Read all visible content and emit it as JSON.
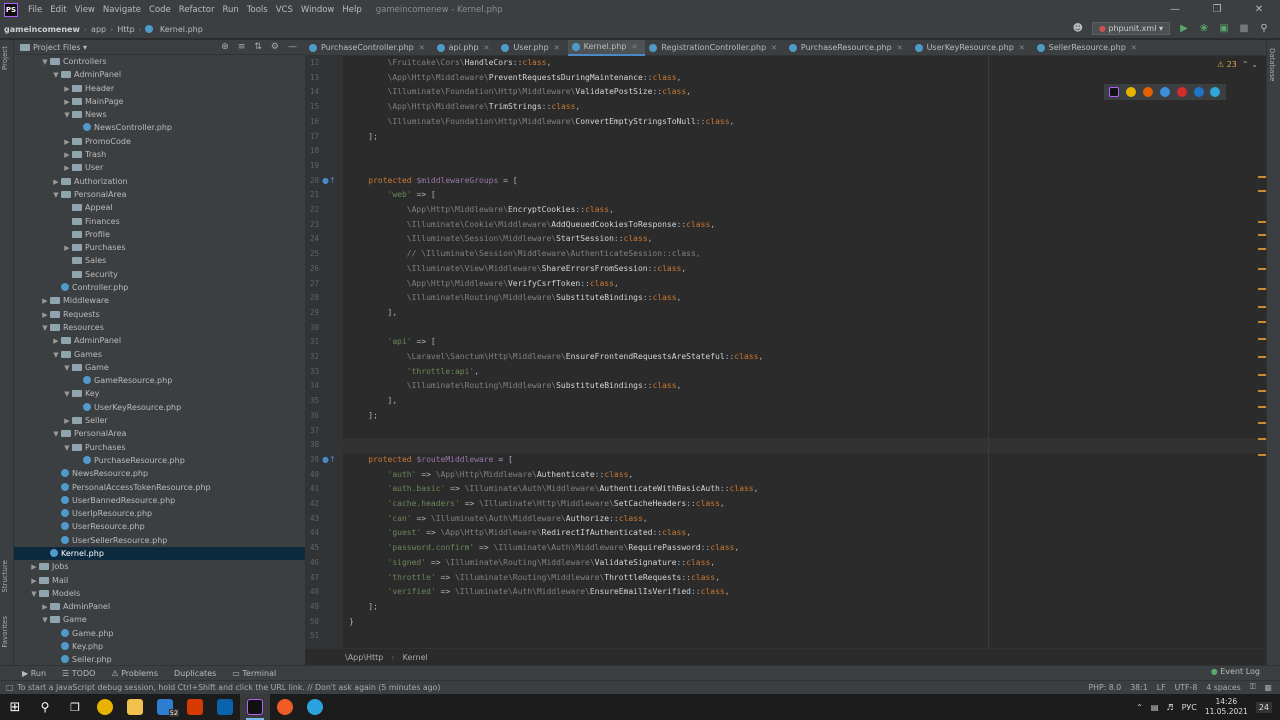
{
  "window": {
    "menu": [
      "File",
      "Edit",
      "View",
      "Navigate",
      "Code",
      "Refactor",
      "Run",
      "Tools",
      "VCS",
      "Window",
      "Help"
    ],
    "title": "gameincomenew - Kernel.php",
    "logo": "PS"
  },
  "navbar": {
    "crumbs": [
      "gameincomenew",
      "app",
      "Http",
      "Kernel.php"
    ],
    "run_config": "phpunit.xml"
  },
  "project": {
    "header": "Project Files",
    "stripe_labels": {
      "project": "Project",
      "structure": "Structure",
      "favorites": "Favorites"
    },
    "tree": [
      {
        "label": "Controllers",
        "type": "folder",
        "depth": 2,
        "arrow": "v"
      },
      {
        "label": "AdminPanel",
        "type": "folder",
        "depth": 3,
        "arrow": "v"
      },
      {
        "label": "Header",
        "type": "folder",
        "depth": 4,
        "arrow": ">"
      },
      {
        "label": "MainPage",
        "type": "folder",
        "depth": 4,
        "arrow": ">"
      },
      {
        "label": "News",
        "type": "folder",
        "depth": 4,
        "arrow": "v"
      },
      {
        "label": "NewsController.php",
        "type": "php",
        "depth": 5,
        "arrow": ""
      },
      {
        "label": "PromoCode",
        "type": "folder",
        "depth": 4,
        "arrow": ">"
      },
      {
        "label": "Trash",
        "type": "folder",
        "depth": 4,
        "arrow": ">"
      },
      {
        "label": "User",
        "type": "folder",
        "depth": 4,
        "arrow": ">"
      },
      {
        "label": "Authorization",
        "type": "folder",
        "depth": 3,
        "arrow": ">"
      },
      {
        "label": "PersonalArea",
        "type": "folder",
        "depth": 3,
        "arrow": "v"
      },
      {
        "label": "Appeal",
        "type": "folder",
        "depth": 4,
        "arrow": ""
      },
      {
        "label": "Finances",
        "type": "folder",
        "depth": 4,
        "arrow": ""
      },
      {
        "label": "Profile",
        "type": "folder",
        "depth": 4,
        "arrow": ""
      },
      {
        "label": "Purchases",
        "type": "folder",
        "depth": 4,
        "arrow": ">"
      },
      {
        "label": "Sales",
        "type": "folder",
        "depth": 4,
        "arrow": ""
      },
      {
        "label": "Security",
        "type": "folder",
        "depth": 4,
        "arrow": ""
      },
      {
        "label": "Controller.php",
        "type": "php",
        "depth": 3,
        "arrow": ""
      },
      {
        "label": "Middleware",
        "type": "folder",
        "depth": 2,
        "arrow": ">"
      },
      {
        "label": "Requests",
        "type": "folder",
        "depth": 2,
        "arrow": ">"
      },
      {
        "label": "Resources",
        "type": "folder",
        "depth": 2,
        "arrow": "v"
      },
      {
        "label": "AdminPanel",
        "type": "folder",
        "depth": 3,
        "arrow": ">"
      },
      {
        "label": "Games",
        "type": "folder",
        "depth": 3,
        "arrow": "v"
      },
      {
        "label": "Game",
        "type": "folder",
        "depth": 4,
        "arrow": "v"
      },
      {
        "label": "GameResource.php",
        "type": "php",
        "depth": 5,
        "arrow": ""
      },
      {
        "label": "Key",
        "type": "folder",
        "depth": 4,
        "arrow": "v"
      },
      {
        "label": "UserKeyResource.php",
        "type": "php",
        "depth": 5,
        "arrow": ""
      },
      {
        "label": "Seller",
        "type": "folder",
        "depth": 4,
        "arrow": ">"
      },
      {
        "label": "PersonalArea",
        "type": "folder",
        "depth": 3,
        "arrow": "v"
      },
      {
        "label": "Purchases",
        "type": "folder",
        "depth": 4,
        "arrow": "v"
      },
      {
        "label": "PurchaseResource.php",
        "type": "php",
        "depth": 5,
        "arrow": ""
      },
      {
        "label": "NewsResource.php",
        "type": "php",
        "depth": 3,
        "arrow": ""
      },
      {
        "label": "PersonalAccessTokenResource.php",
        "type": "php",
        "depth": 3,
        "arrow": ""
      },
      {
        "label": "UserBannedResource.php",
        "type": "php",
        "depth": 3,
        "arrow": ""
      },
      {
        "label": "UserIpResource.php",
        "type": "php",
        "depth": 3,
        "arrow": ""
      },
      {
        "label": "UserResource.php",
        "type": "php",
        "depth": 3,
        "arrow": ""
      },
      {
        "label": "UserSellerResource.php",
        "type": "php",
        "depth": 3,
        "arrow": ""
      },
      {
        "label": "Kernel.php",
        "type": "php",
        "depth": 2,
        "arrow": "",
        "selected": true
      },
      {
        "label": "Jobs",
        "type": "folder",
        "depth": 1,
        "arrow": ">"
      },
      {
        "label": "Mail",
        "type": "folder",
        "depth": 1,
        "arrow": ">"
      },
      {
        "label": "Models",
        "type": "folder",
        "depth": 1,
        "arrow": "v"
      },
      {
        "label": "AdminPanel",
        "type": "folder",
        "depth": 2,
        "arrow": ">"
      },
      {
        "label": "Game",
        "type": "folder",
        "depth": 2,
        "arrow": "v"
      },
      {
        "label": "Game.php",
        "type": "php",
        "depth": 3,
        "arrow": ""
      },
      {
        "label": "Key.php",
        "type": "php",
        "depth": 3,
        "arrow": ""
      },
      {
        "label": "Seller.php",
        "type": "php",
        "depth": 3,
        "arrow": ""
      }
    ]
  },
  "tabs": [
    {
      "label": "PurchaseController.php",
      "active": false
    },
    {
      "label": "api.php",
      "active": false
    },
    {
      "label": "User.php",
      "active": false
    },
    {
      "label": "Kernel.php",
      "active": true
    },
    {
      "label": "RegistrationController.php",
      "active": false
    },
    {
      "label": "PurchaseResource.php",
      "active": false
    },
    {
      "label": "UserKeyResource.php",
      "active": false
    },
    {
      "label": "SellerResource.php",
      "active": false
    }
  ],
  "editor": {
    "warning_count": "23",
    "lines": [
      {
        "n": "12",
        "segs": [
          [
            "ns",
            "        \\Fruitcake\\Cors\\"
          ],
          [
            "cls",
            "HandleCors"
          ],
          [
            "",
            "::"
          ],
          [
            "kw",
            "class"
          ],
          [
            "",
            ","
          ]
        ]
      },
      {
        "n": "13",
        "segs": [
          [
            "ns",
            "        \\App\\Http\\Middleware\\"
          ],
          [
            "cls",
            "PreventRequestsDuringMaintenance"
          ],
          [
            "",
            "::"
          ],
          [
            "kw",
            "class"
          ],
          [
            "",
            ","
          ]
        ]
      },
      {
        "n": "14",
        "segs": [
          [
            "ns",
            "        \\Illuminate\\Foundation\\Http\\Middleware\\"
          ],
          [
            "cls",
            "ValidatePostSize"
          ],
          [
            "",
            "::"
          ],
          [
            "kw",
            "class"
          ],
          [
            "",
            ","
          ]
        ]
      },
      {
        "n": "15",
        "segs": [
          [
            "ns",
            "        \\App\\Http\\Middleware\\"
          ],
          [
            "cls",
            "TrimStrings"
          ],
          [
            "",
            "::"
          ],
          [
            "kw",
            "class"
          ],
          [
            "",
            ","
          ]
        ]
      },
      {
        "n": "16",
        "segs": [
          [
            "ns",
            "        \\Illuminate\\Foundation\\Http\\Middleware\\"
          ],
          [
            "cls",
            "ConvertEmptyStringsToNull"
          ],
          [
            "",
            "::"
          ],
          [
            "kw",
            "class"
          ],
          [
            "",
            ","
          ]
        ]
      },
      {
        "n": "17",
        "segs": [
          [
            "",
            "    ];"
          ]
        ]
      },
      {
        "n": "18",
        "segs": []
      },
      {
        "n": "19",
        "segs": []
      },
      {
        "n": "20",
        "segs": [
          [
            "kw",
            "    protected "
          ],
          [
            "var",
            "$middlewareGroups"
          ],
          [
            "",
            " = ["
          ]
        ]
      },
      {
        "n": "21",
        "segs": [
          [
            "str",
            "        'web'"
          ],
          [
            "",
            " => ["
          ]
        ]
      },
      {
        "n": "22",
        "segs": [
          [
            "ns",
            "            \\App\\Http\\Middleware\\"
          ],
          [
            "cls",
            "EncryptCookies"
          ],
          [
            "",
            "::"
          ],
          [
            "kw",
            "class"
          ],
          [
            "",
            ","
          ]
        ]
      },
      {
        "n": "23",
        "segs": [
          [
            "ns",
            "            \\Illuminate\\Cookie\\Middleware\\"
          ],
          [
            "cls",
            "AddQueuedCookiesToResponse"
          ],
          [
            "",
            "::"
          ],
          [
            "kw",
            "class"
          ],
          [
            "",
            ","
          ]
        ]
      },
      {
        "n": "24",
        "segs": [
          [
            "ns",
            "            \\Illuminate\\Session\\Middleware\\"
          ],
          [
            "cls",
            "StartSession"
          ],
          [
            "",
            "::"
          ],
          [
            "kw",
            "class"
          ],
          [
            "",
            ","
          ]
        ]
      },
      {
        "n": "25",
        "segs": [
          [
            "cmt",
            "            // \\Illuminate\\Session\\Middleware\\AuthenticateSession::class,"
          ]
        ]
      },
      {
        "n": "26",
        "segs": [
          [
            "ns",
            "            \\Illuminate\\View\\Middleware\\"
          ],
          [
            "cls",
            "ShareErrorsFromSession"
          ],
          [
            "",
            "::"
          ],
          [
            "kw",
            "class"
          ],
          [
            "",
            ","
          ]
        ]
      },
      {
        "n": "27",
        "segs": [
          [
            "ns",
            "            \\App\\Http\\Middleware\\"
          ],
          [
            "cls",
            "VerifyCsrfToken"
          ],
          [
            "",
            "::"
          ],
          [
            "kw",
            "class"
          ],
          [
            "",
            ","
          ]
        ]
      },
      {
        "n": "28",
        "segs": [
          [
            "ns",
            "            \\Illuminate\\Routing\\Middleware\\"
          ],
          [
            "cls",
            "SubstituteBindings"
          ],
          [
            "",
            "::"
          ],
          [
            "kw",
            "class"
          ],
          [
            "",
            ","
          ]
        ]
      },
      {
        "n": "29",
        "segs": [
          [
            "",
            "        ],"
          ]
        ]
      },
      {
        "n": "30",
        "segs": []
      },
      {
        "n": "31",
        "segs": [
          [
            "str",
            "        'api'"
          ],
          [
            "",
            " => ["
          ]
        ]
      },
      {
        "n": "32",
        "segs": [
          [
            "ns",
            "            \\Laravel\\Sanctum\\Http\\Middleware\\"
          ],
          [
            "cls",
            "EnsureFrontendRequestsAreStateful"
          ],
          [
            "",
            "::"
          ],
          [
            "kw",
            "class"
          ],
          [
            "",
            ","
          ]
        ]
      },
      {
        "n": "33",
        "segs": [
          [
            "str",
            "            'throttle:api'"
          ],
          [
            "",
            ","
          ]
        ]
      },
      {
        "n": "34",
        "segs": [
          [
            "ns",
            "            \\Illuminate\\Routing\\Middleware\\"
          ],
          [
            "cls",
            "SubstituteBindings"
          ],
          [
            "",
            "::"
          ],
          [
            "kw",
            "class"
          ],
          [
            "",
            ","
          ]
        ]
      },
      {
        "n": "35",
        "segs": [
          [
            "",
            "        ],"
          ]
        ]
      },
      {
        "n": "36",
        "segs": [
          [
            "",
            "    ];"
          ]
        ]
      },
      {
        "n": "37",
        "segs": []
      },
      {
        "n": "38",
        "segs": []
      },
      {
        "n": "39",
        "segs": [
          [
            "kw",
            "    protected "
          ],
          [
            "var",
            "$routeMiddleware"
          ],
          [
            "",
            " = ["
          ]
        ]
      },
      {
        "n": "40",
        "segs": [
          [
            "str",
            "        'auth'"
          ],
          [
            "",
            " => "
          ],
          [
            "ns",
            "\\App\\Http\\Middleware\\"
          ],
          [
            "cls",
            "Authenticate"
          ],
          [
            "",
            "::"
          ],
          [
            "kw",
            "class"
          ],
          [
            "",
            ","
          ]
        ]
      },
      {
        "n": "41",
        "segs": [
          [
            "str",
            "        'auth.basic'"
          ],
          [
            "",
            " => "
          ],
          [
            "ns",
            "\\Illuminate\\Auth\\Middleware\\"
          ],
          [
            "cls",
            "AuthenticateWithBasicAuth"
          ],
          [
            "",
            "::"
          ],
          [
            "kw",
            "class"
          ],
          [
            "",
            ","
          ]
        ]
      },
      {
        "n": "42",
        "segs": [
          [
            "str",
            "        'cache.headers'"
          ],
          [
            "",
            " => "
          ],
          [
            "ns",
            "\\Illuminate\\Http\\Middleware\\"
          ],
          [
            "cls",
            "SetCacheHeaders"
          ],
          [
            "",
            "::"
          ],
          [
            "kw",
            "class"
          ],
          [
            "",
            ","
          ]
        ]
      },
      {
        "n": "43",
        "segs": [
          [
            "str",
            "        'can'"
          ],
          [
            "",
            " => "
          ],
          [
            "ns",
            "\\Illuminate\\Auth\\Middleware\\"
          ],
          [
            "cls",
            "Authorize"
          ],
          [
            "",
            "::"
          ],
          [
            "kw",
            "class"
          ],
          [
            "",
            ","
          ]
        ]
      },
      {
        "n": "44",
        "segs": [
          [
            "str",
            "        'guest'"
          ],
          [
            "",
            " => "
          ],
          [
            "ns",
            "\\App\\Http\\Middleware\\"
          ],
          [
            "cls",
            "RedirectIfAuthenticated"
          ],
          [
            "",
            "::"
          ],
          [
            "kw",
            "class"
          ],
          [
            "",
            ","
          ]
        ]
      },
      {
        "n": "45",
        "segs": [
          [
            "str",
            "        'password.confirm'"
          ],
          [
            "",
            " => "
          ],
          [
            "ns",
            "\\Illuminate\\Auth\\Middleware\\"
          ],
          [
            "cls",
            "RequirePassword"
          ],
          [
            "",
            "::"
          ],
          [
            "kw",
            "class"
          ],
          [
            "",
            ","
          ]
        ]
      },
      {
        "n": "46",
        "segs": [
          [
            "str",
            "        'signed'"
          ],
          [
            "",
            " => "
          ],
          [
            "ns",
            "\\Illuminate\\Routing\\Middleware\\"
          ],
          [
            "cls",
            "ValidateSignature"
          ],
          [
            "",
            "::"
          ],
          [
            "kw",
            "class"
          ],
          [
            "",
            ","
          ]
        ]
      },
      {
        "n": "47",
        "segs": [
          [
            "str",
            "        'throttle'"
          ],
          [
            "",
            " => "
          ],
          [
            "ns",
            "\\Illuminate\\Routing\\Middleware\\"
          ],
          [
            "cls",
            "ThrottleRequests"
          ],
          [
            "",
            "::"
          ],
          [
            "kw",
            "class"
          ],
          [
            "",
            ","
          ]
        ]
      },
      {
        "n": "48",
        "segs": [
          [
            "str",
            "        'verified'"
          ],
          [
            "",
            " => "
          ],
          [
            "ns",
            "\\Illuminate\\Auth\\Middleware\\"
          ],
          [
            "cls",
            "EnsureEmailIsVerified"
          ],
          [
            "",
            "::"
          ],
          [
            "kw",
            "class"
          ],
          [
            "",
            ","
          ]
        ]
      },
      {
        "n": "49",
        "segs": [
          [
            "",
            "    ];"
          ]
        ]
      },
      {
        "n": "50",
        "segs": [
          [
            "",
            "}"
          ]
        ]
      },
      {
        "n": "51",
        "segs": []
      }
    ],
    "breadcrumb": [
      "\\App\\Http",
      "Kernel"
    ]
  },
  "toolwindows": [
    "Run",
    "TODO",
    "Problems",
    "Duplicates",
    "Terminal"
  ],
  "event_log": "Event Log",
  "status": {
    "message": "To start a JavaScript debug session, hold Ctrl+Shift and click the URL link. // Don't ask again (5 minutes ago)",
    "php": "PHP: 8.0",
    "position": "38:1",
    "line_sep": "LF",
    "encoding": "UTF-8",
    "indent": "4 spaces"
  },
  "taskbar": {
    "badge": "52",
    "lang": "РУС",
    "time": "14:26",
    "date": "11.05.2021",
    "notif": "24"
  },
  "colors": {
    "accent": "#4a88c7",
    "keyword": "#cc7832",
    "string": "#6a8759",
    "variable": "#9876aa"
  }
}
